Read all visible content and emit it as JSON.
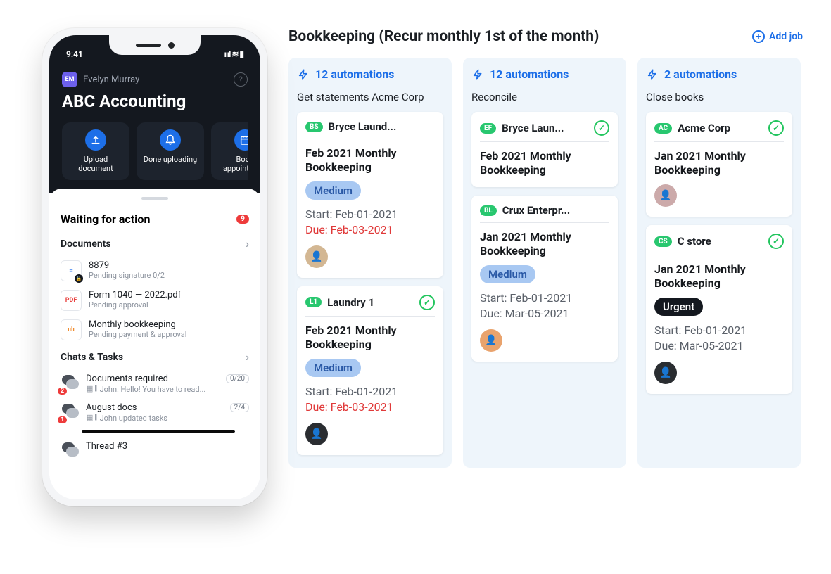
{
  "phone": {
    "time": "9:41",
    "user_initials": "EM",
    "user_name": "Evelyn Murray",
    "company": "ABC Accounting",
    "actions": [
      {
        "label": "Upload document"
      },
      {
        "label": "Done uploading"
      },
      {
        "label": "Book appointment"
      }
    ],
    "waiting_title": "Waiting for action",
    "waiting_count": "9",
    "documents_title": "Documents",
    "documents": [
      {
        "title": "8879",
        "meta": "Pending signature 0/2",
        "kind": "doc",
        "corner": "lock"
      },
      {
        "title": "Form 1040 — 2022.pdf",
        "meta": "Pending approval",
        "kind": "pdf"
      },
      {
        "title": "Monthly bookkeeping",
        "meta": "Pending payment & approval",
        "kind": "ppt"
      }
    ],
    "chats_title": "Chats & Tasks",
    "chats": [
      {
        "title": "Documents required",
        "preview": "John: Hello! You have to read...",
        "badge": "2",
        "count": "0/20"
      },
      {
        "title": "August docs",
        "preview": "John updated tasks",
        "badge": "1",
        "count": "2/4"
      },
      {
        "title": "Thread #3",
        "preview": "",
        "badge": "",
        "count": ""
      }
    ]
  },
  "board": {
    "title": "Bookkeeping (Recur monthly 1st of the month)",
    "add_job": "Add job",
    "columns": [
      {
        "automations": "12 automations",
        "subtitle": "Get statements Acme Corp",
        "cards": [
          {
            "tag": "BS",
            "client": "Bryce Laund...",
            "check": false,
            "title": "Feb 2021 Monthly Bookkeeping",
            "priority": "Medium",
            "start": "Start: Feb-01-2021",
            "due": "Due: Feb-03-2021",
            "due_red": true,
            "avatar": "a1"
          },
          {
            "tag": "L1",
            "client": "Laundry 1",
            "check": true,
            "title": "Feb 2021 Monthly Bookkeeping",
            "priority": "Medium",
            "start": "Start: Feb-01-2021",
            "due": "Due: Feb-03-2021",
            "due_red": true,
            "avatar": "a3"
          }
        ]
      },
      {
        "automations": "12 automations",
        "subtitle": "Reconcile",
        "cards": [
          {
            "tag": "EF",
            "client": "Bryce Laun...",
            "check": true,
            "title": "Feb 2021 Monthly Bookkeeping"
          },
          {
            "tag": "BL",
            "client": "Crux Enterpr...",
            "check": false,
            "title": "Jan 2021 Monthly Bookkeeping",
            "priority": "Medium",
            "start": "Start: Feb-01-2021",
            "due": "Due: Mar-05-2021",
            "due_red": false,
            "avatar": "a2"
          }
        ]
      },
      {
        "automations": "2 automations",
        "subtitle": "Close books",
        "cards": [
          {
            "tag": "AC",
            "client": "Acme Corp",
            "check": true,
            "title": "Jan 2021 Monthly Bookkeeping",
            "avatar": "a4"
          },
          {
            "tag": "CS",
            "client": "C store",
            "check": true,
            "title": "Jan 2021 Monthly Bookkeeping",
            "priority": "Urgent",
            "start": "Start: Feb-01-2021",
            "due": "Due: Mar-05-2021",
            "due_red": false,
            "avatar": "a3"
          }
        ]
      }
    ]
  }
}
